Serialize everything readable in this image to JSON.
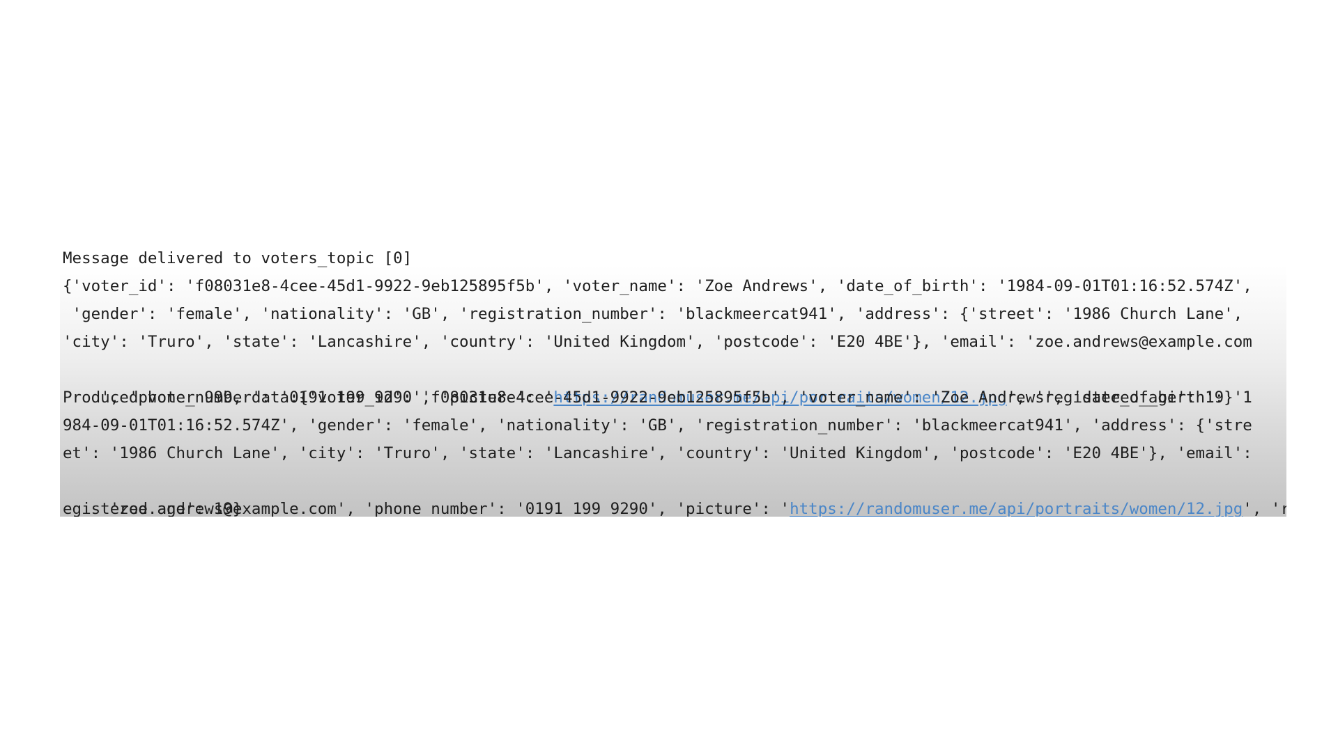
{
  "console": {
    "lines": [
      {
        "text": "Message delivered to voters_topic [0]"
      },
      {
        "text": "{'voter_id': 'f08031e8-4cee-45d1-9922-9eb125895f5b', 'voter_name': 'Zoe Andrews', 'date_of_birth': '1984-09-01T01:16:52.574Z',"
      },
      {
        "text": " 'gender': 'female', 'nationality': 'GB', 'registration_number': 'blackmeercat941', 'address': {'street': '1986 Church Lane',"
      },
      {
        "text": "'city': 'Truro', 'state': 'Lancashire', 'country': 'United Kingdom', 'postcode': 'E20 4BE'}, 'email': 'zoe.andrews@example.com"
      },
      {
        "pre": "', 'phone_number': '0191 199 9290', 'picture': '",
        "link": "https://randomuser.me/api/portraits/women/12.jpg",
        "post": "', 'registered_age': 19}"
      },
      {
        "text": "Produced voter 999, data:{'voter_id': 'f08031e8-4cee-45d1-9922-9eb125895f5b', 'voter_name': 'Zoe Andrews', 'date_of_birth': '1"
      },
      {
        "text": "984-09-01T01:16:52.574Z', 'gender': 'female', 'nationality': 'GB', 'registration_number': 'blackmeercat941', 'address': {'stre"
      },
      {
        "text": "et': '1986 Church Lane', 'city': 'Truro', 'state': 'Lancashire', 'country': 'United Kingdom', 'postcode': 'E20 4BE'}, 'email':"
      },
      {
        "pre": " 'zoe.andrews@example.com', 'phone_number': '0191 199 9290', 'picture': '",
        "link": "https://randomuser.me/api/portraits/women/12.jpg",
        "post": "', 'r"
      },
      {
        "text": "egistered_age': 19}"
      }
    ]
  }
}
